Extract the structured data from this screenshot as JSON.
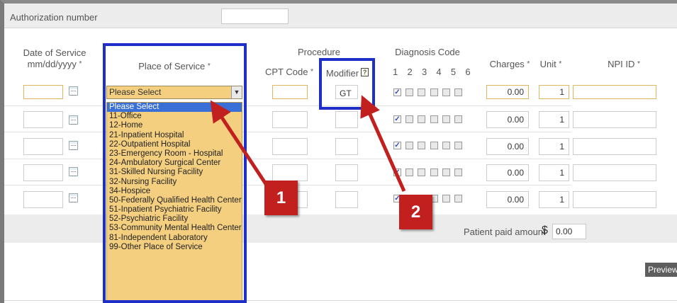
{
  "authorization": {
    "label": "Authorization number",
    "value": ""
  },
  "headers": {
    "date_of_service": "Date of Service",
    "date_format": "mm/dd/yyyy",
    "place_of_service": "Place of Service",
    "procedure": "Procedure",
    "cpt_code": "CPT Code",
    "modifier": "Modifier",
    "modifier_help": "?",
    "diagnosis_code": "Diagnosis Code",
    "diagnosis_numbers": [
      "1",
      "2",
      "3",
      "4",
      "5",
      "6"
    ],
    "charges": "Charges",
    "unit": "Unit",
    "npi_id": "NPI ID",
    "required_mark": "*"
  },
  "rows": [
    {
      "modifier": "GT",
      "charges": "0.00",
      "unit": "1",
      "diag_checked": [
        true,
        false,
        false,
        false,
        false,
        false
      ]
    },
    {
      "modifier": "",
      "charges": "0.00",
      "unit": "1",
      "diag_checked": [
        true,
        false,
        false,
        false,
        false,
        false
      ]
    },
    {
      "modifier": "",
      "charges": "0.00",
      "unit": "1",
      "diag_checked": [
        true,
        false,
        false,
        false,
        false,
        false
      ]
    },
    {
      "modifier": "",
      "charges": "0.00",
      "unit": "1",
      "diag_checked": [
        true,
        false,
        false,
        false,
        false,
        false
      ]
    },
    {
      "modifier": "",
      "charges": "0.00",
      "unit": "1",
      "diag_checked": [
        true,
        false,
        false,
        false,
        false,
        false
      ]
    }
  ],
  "place_of_service_select": {
    "selected": "Please Select",
    "options": [
      "Please Select",
      "11-Office",
      "12-Home",
      "21-Inpatient Hospital",
      "22-Outpatient Hospital",
      "23-Emergency Room - Hospital",
      "24-Ambulatory Surgical Center",
      "31-Skilled Nursing Facility",
      "32-Nursing Facility",
      "34-Hospice",
      "50-Federally Qualified Health Center",
      "51-Inpatient Psychiatric Facility",
      "52-Psychiatric Facility",
      "53-Community Mental Health Center",
      "81-Independent Laboratory",
      "99-Other Place of Service"
    ]
  },
  "patient_paid": {
    "label": "Patient paid amount",
    "currency": "$",
    "value": "0.00"
  },
  "preview_label": "Preview",
  "callouts": [
    "1",
    "2"
  ],
  "colors": {
    "highlight": "#f4cf7f",
    "callout_red": "#c21f1f",
    "focus_blue": "#1d2ec9",
    "arrow_red": "#c21f1f"
  }
}
